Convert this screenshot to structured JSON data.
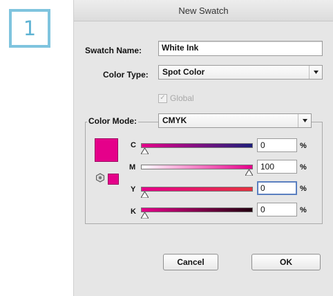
{
  "step_badge": "1",
  "dialog": {
    "title": "New Swatch",
    "swatch_name_label": "Swatch Name:",
    "swatch_name_value": "White Ink",
    "color_type_label": "Color Type:",
    "color_type_value": "Spot Color",
    "global_label": "Global",
    "global_checked": true,
    "color_mode_label": "Color Mode:",
    "color_mode_value": "CMYK",
    "swatch_color": "#e5008a",
    "channels": [
      {
        "label": "C",
        "value": "0",
        "unit": "%",
        "percent": 0
      },
      {
        "label": "M",
        "value": "100",
        "unit": "%",
        "percent": 100
      },
      {
        "label": "Y",
        "value": "0",
        "unit": "%",
        "percent": 0
      },
      {
        "label": "K",
        "value": "0",
        "unit": "%",
        "percent": 0
      }
    ],
    "cancel_label": "Cancel",
    "ok_label": "OK"
  }
}
